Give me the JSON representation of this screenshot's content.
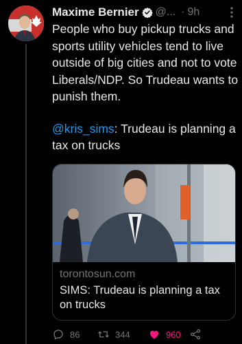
{
  "tweet": {
    "author_name": "Maxime Bernier",
    "handle": "@...",
    "separator": "·",
    "time": "9h",
    "text_paragraph_1": "People who buy pickup trucks and sports utility vehicles tend to live outside of big cities and not to vote Liberals/NDP. So Trudeau wants to punish them.",
    "quote_mention": "@kris_sims",
    "quote_text": ": Trudeau is planning a tax on trucks"
  },
  "link_card": {
    "domain": "torontosun.com",
    "title": "SIMS: Trudeau is planning a tax on trucks"
  },
  "actions": {
    "replies": "86",
    "retweets": "344",
    "likes": "960"
  },
  "colors": {
    "background": "#000000",
    "text": "#e7e9ea",
    "muted": "#71767b",
    "link": "#1d9bf0",
    "like": "#f91880",
    "border": "#2f3336"
  },
  "icons": [
    "verified-badge-icon",
    "more-options-icon",
    "reply-icon",
    "retweet-icon",
    "like-icon",
    "share-icon"
  ]
}
